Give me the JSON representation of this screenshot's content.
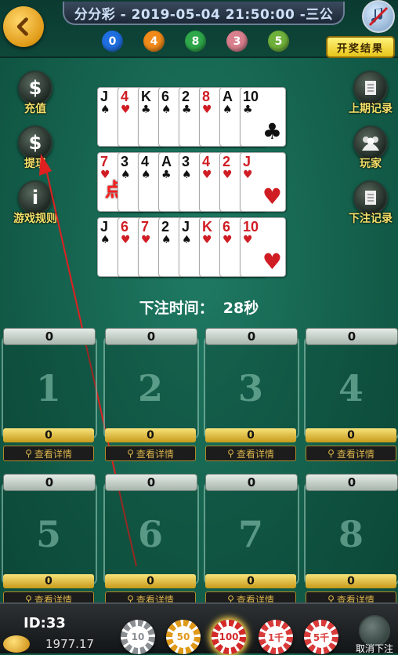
{
  "header": {
    "title": "分分彩 - 2019-05-04 21:50:00 -三公",
    "result_button": "开奖结果",
    "balls": [
      {
        "value": "0",
        "color": "#1f6fe0"
      },
      {
        "value": "4",
        "color": "#f08a1a"
      },
      {
        "value": "8",
        "color": "#2fa84a"
      },
      {
        "value": "3",
        "color": "#d9808e"
      },
      {
        "value": "5",
        "color": "#6fb03a"
      }
    ]
  },
  "left_menu": [
    {
      "label": "充值",
      "icon": "dollar-icon"
    },
    {
      "label": "提现",
      "icon": "dollar-icon"
    },
    {
      "label": "游戏规则",
      "icon": "info-icon"
    }
  ],
  "right_menu": [
    {
      "label": "上期记录",
      "icon": "document-icon"
    },
    {
      "label": "玩家",
      "icon": "players-icon"
    },
    {
      "label": "下注记录",
      "icon": "document-icon"
    }
  ],
  "card_rows": [
    [
      {
        "rank": "J",
        "suit": "♠"
      },
      {
        "rank": "4",
        "suit": "♥"
      },
      {
        "rank": "K",
        "suit": "♣"
      },
      {
        "rank": "6",
        "suit": "♠"
      },
      {
        "rank": "2",
        "suit": "♣"
      },
      {
        "rank": "8",
        "suit": "♥"
      },
      {
        "rank": "A",
        "suit": "♠"
      },
      {
        "rank": "10",
        "suit": "♣"
      }
    ],
    [
      {
        "rank": "7",
        "suit": "♥"
      },
      {
        "rank": "3",
        "suit": "♠"
      },
      {
        "rank": "4",
        "suit": "♠"
      },
      {
        "rank": "A",
        "suit": "♣"
      },
      {
        "rank": "3",
        "suit": "♠"
      },
      {
        "rank": "4",
        "suit": "♥"
      },
      {
        "rank": "2",
        "suit": "♥"
      },
      {
        "rank": "J",
        "suit": "♥"
      }
    ],
    [
      {
        "rank": "J",
        "suit": "♠"
      },
      {
        "rank": "6",
        "suit": "♥"
      },
      {
        "rank": "7",
        "suit": "♥"
      },
      {
        "rank": "2",
        "suit": "♠"
      },
      {
        "rank": "J",
        "suit": "♠"
      },
      {
        "rank": "K",
        "suit": "♥"
      },
      {
        "rank": "6",
        "suit": "♥"
      },
      {
        "rank": "10",
        "suit": "♥"
      }
    ]
  ],
  "overlay_text": "点击提现",
  "timer": {
    "label": "下注时间：",
    "value": "28秒"
  },
  "boxes": [
    {
      "number": "1",
      "top": "0",
      "bottom": "0"
    },
    {
      "number": "2",
      "top": "0",
      "bottom": "0"
    },
    {
      "number": "3",
      "top": "0",
      "bottom": "0"
    },
    {
      "number": "4",
      "top": "0",
      "bottom": "0"
    },
    {
      "number": "5",
      "top": "0",
      "bottom": "0"
    },
    {
      "number": "6",
      "top": "0",
      "bottom": "0"
    },
    {
      "number": "7",
      "top": "0",
      "bottom": "0"
    },
    {
      "number": "8",
      "top": "0",
      "bottom": "0"
    }
  ],
  "detail_label": "查看详情",
  "player": {
    "id": "ID:33",
    "balance": "1977.17"
  },
  "chips": [
    {
      "label": "10",
      "color": "#8b8f94"
    },
    {
      "label": "50",
      "color": "#e09a1a"
    },
    {
      "label": "100",
      "color": "#d42a2a"
    },
    {
      "label": "1千",
      "color": "#d93a3a"
    },
    {
      "label": "5千",
      "color": "#d93a3a"
    }
  ],
  "cancel_label": "取消下注"
}
